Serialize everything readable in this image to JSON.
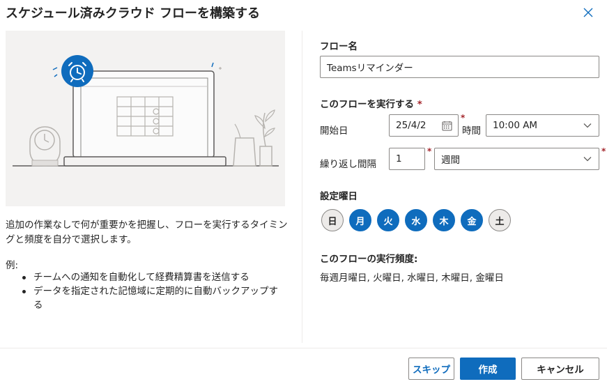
{
  "dialog": {
    "title": "スケジュール済みクラウド フローを構築する"
  },
  "left": {
    "description": "追加の作業なしで何が重要かを把握し、フローを実行するタイミングと頻度を自分で選択します。",
    "examples_label": "例:",
    "examples": [
      "チームへの通知を自動化して経費精算書を送信する",
      "データを指定された記憶域に定期的に自動バックアップする"
    ]
  },
  "form": {
    "flow_name_label": "フロー名",
    "flow_name_value": "Teamsリマインダー",
    "run_label": "このフローを実行する",
    "required_mark": "*",
    "start_date_label": "開始日",
    "start_date_value": "25/4/2",
    "time_label": "時間",
    "time_value": "10:00 AM",
    "repeat_label": "繰り返し間隔",
    "repeat_interval": "1",
    "repeat_unit": "週間",
    "weekdays_label": "設定曜日",
    "weekdays": [
      {
        "label": "日",
        "selected": false
      },
      {
        "label": "月",
        "selected": true
      },
      {
        "label": "火",
        "selected": true
      },
      {
        "label": "水",
        "selected": true
      },
      {
        "label": "木",
        "selected": true
      },
      {
        "label": "金",
        "selected": true
      },
      {
        "label": "土",
        "selected": false
      }
    ],
    "frequency_label": "このフローの実行頻度:",
    "frequency_value": "毎週月曜日, 火曜日, 水曜日, 木曜日, 金曜日"
  },
  "footer": {
    "skip_label": "スキップ",
    "create_label": "作成",
    "cancel_label": "キャンセル"
  },
  "colors": {
    "accent": "#0f6cbd",
    "required": "#a4262c",
    "illustration_bg": "#f3f2f1"
  }
}
